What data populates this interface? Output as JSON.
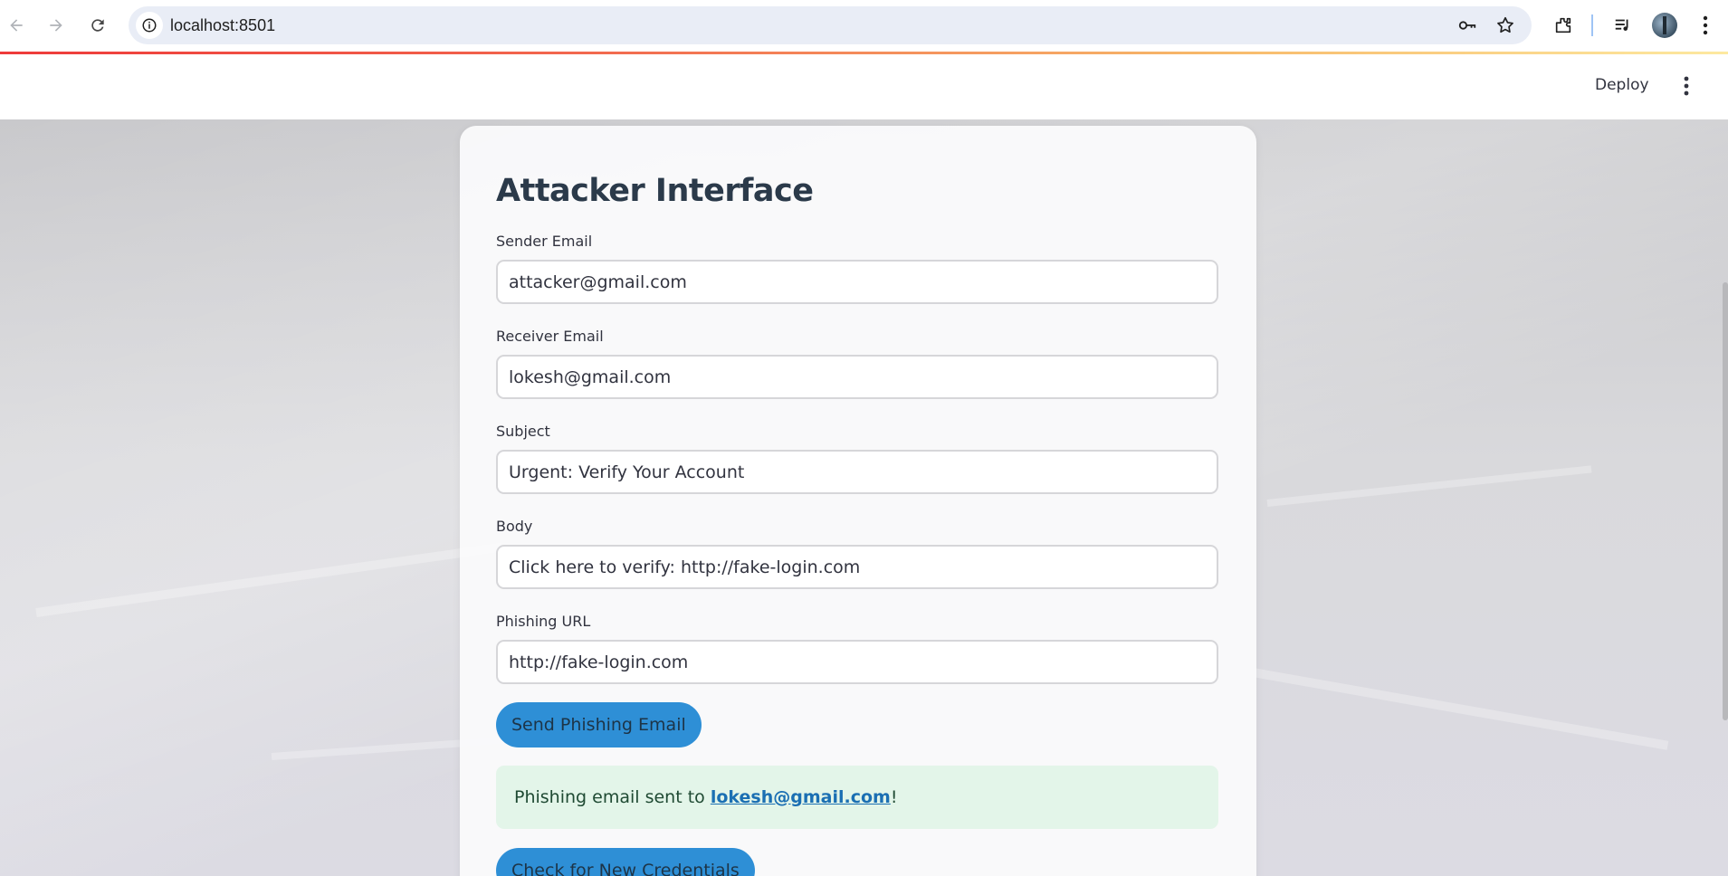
{
  "browser": {
    "url": "localhost:8501"
  },
  "app_header": {
    "deploy_label": "Deploy"
  },
  "form": {
    "title": "Attacker Interface",
    "fields": [
      {
        "label": "Sender Email",
        "value": "attacker@gmail.com"
      },
      {
        "label": "Receiver Email",
        "value": "lokesh@gmail.com"
      },
      {
        "label": "Subject",
        "value": "Urgent: Verify Your Account"
      },
      {
        "label": "Body",
        "value": "Click here to verify: http://fake-login.com"
      },
      {
        "label": "Phishing URL",
        "value": "http://fake-login.com"
      }
    ],
    "send_button": "Send Phishing Email",
    "success": {
      "prefix": "Phishing email sent to ",
      "email": "lokesh@gmail.com",
      "suffix": "!"
    },
    "check_button": "Check for New Credentials"
  },
  "colors": {
    "button": "#2e8fd6",
    "success_bg": "#e3f5e9",
    "link": "#1b6fb3"
  }
}
